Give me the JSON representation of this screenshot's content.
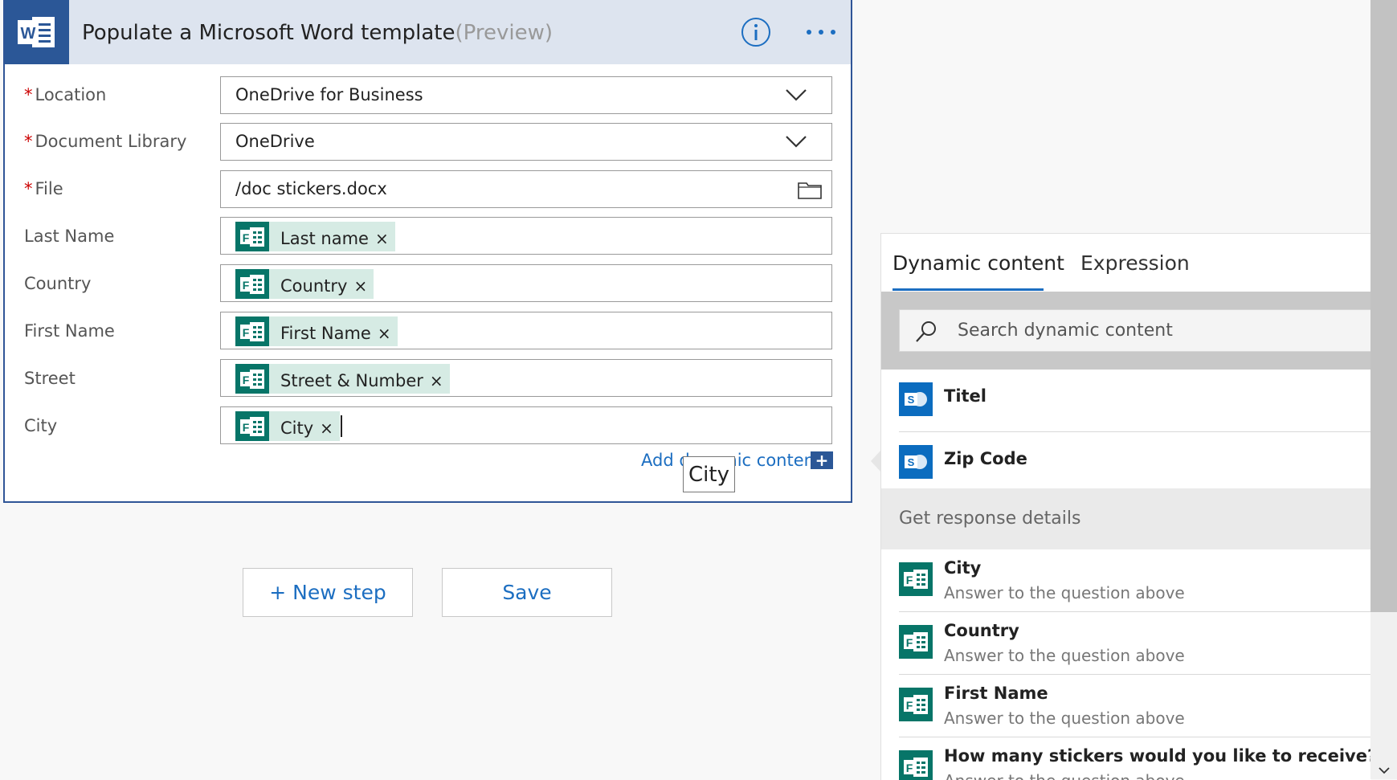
{
  "card": {
    "title": "Populate a Microsoft Word template",
    "preview": "(Preview)"
  },
  "fields": {
    "location_label": "Location",
    "location_value": "OneDrive for Business",
    "library_label": "Document Library",
    "library_value": "OneDrive",
    "file_label": "File",
    "file_value": "/doc stickers.docx",
    "lastname_label": "Last Name",
    "lastname_token": "Last name",
    "country_label": "Country",
    "country_token": "Country",
    "firstname_label": "First Name",
    "firstname_token": "First Name",
    "street_label": "Street",
    "street_token": "Street & Number",
    "city_label": "City",
    "city_token": "City",
    "required_mark": "*",
    "token_close": "×"
  },
  "add_dynamic": "Add dynamic content",
  "tooltip": "City",
  "buttons": {
    "new_step": "+ New step",
    "save": "Save"
  },
  "panel": {
    "tab_dynamic": "Dynamic content",
    "tab_expression": "Expression",
    "search_placeholder": "Search dynamic content",
    "items_top": [
      {
        "name": "Titel"
      },
      {
        "name": "Zip Code"
      }
    ],
    "section_title": "Get response details",
    "items_forms": [
      {
        "name": "City",
        "desc": "Answer to the question above"
      },
      {
        "name": "Country",
        "desc": "Answer to the question above"
      },
      {
        "name": "First Name",
        "desc": "Answer to the question above"
      },
      {
        "name": "How many stickers would you like to receive?",
        "desc": "Answer to the question above"
      }
    ]
  },
  "colors": {
    "accent": "#1c6ec1",
    "word_blue": "#2b5797",
    "forms_green": "#077568",
    "sharepoint_blue": "#0b6cbf"
  }
}
